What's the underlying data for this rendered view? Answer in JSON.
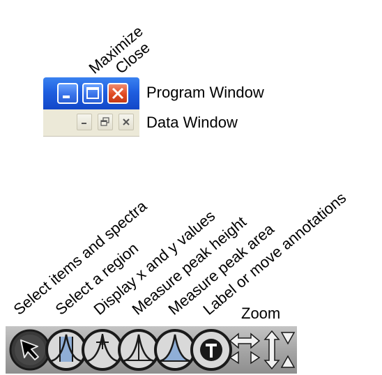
{
  "window_controls": {
    "labels": {
      "maximize": "Maximize",
      "close": "Close",
      "program_window": "Program Window",
      "data_window": "Data Window"
    },
    "program_title_bar_colors": {
      "bar": "#1f5fe0",
      "button_blue": "#3a74ea",
      "button_close_red": "#e04a22"
    },
    "data_strip_color": "#ece9d8"
  },
  "toolbar": {
    "labels": {
      "select_items": "Select items and spectra",
      "select_region": "Select a region",
      "display_xy": "Display x and y values",
      "measure_height": "Measure peak height",
      "measure_area": "Measure peak area",
      "label_annotations": "Label or move annotations",
      "zoom": "Zoom"
    },
    "tools": [
      {
        "icon": "arrow-pointer-icon",
        "active": true
      },
      {
        "icon": "region-peak-icon",
        "active": false
      },
      {
        "icon": "crosshair-peak-icon",
        "active": false
      },
      {
        "icon": "peak-height-icon",
        "active": false
      },
      {
        "icon": "peak-area-icon",
        "active": false
      },
      {
        "icon": "text-t-icon",
        "active": false
      },
      {
        "icon": "zoom-horizontal-icon",
        "active": false
      },
      {
        "icon": "zoom-vertical-icon",
        "active": false
      }
    ]
  }
}
